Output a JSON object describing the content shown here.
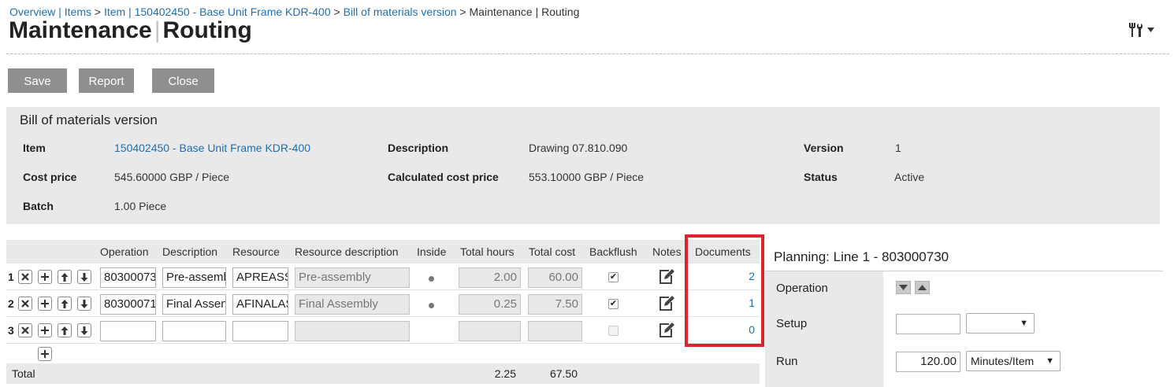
{
  "breadcrumb": {
    "links": [
      "Overview | Items",
      "Item | 150402450 - Base Unit Frame KDR-400",
      "Bill of materials version"
    ],
    "separator": " > ",
    "current": "Maintenance | Routing"
  },
  "title": {
    "part1": "Maintenance",
    "part2": "Routing"
  },
  "toolbar": {
    "save": "Save",
    "report": "Report",
    "close": "Close"
  },
  "bom": {
    "heading": "Bill of materials version",
    "fields": {
      "item_label": "Item",
      "item_value": "150402450 - Base Unit Frame KDR-400",
      "cost_label": "Cost price",
      "cost_value": "545.60000 GBP / Piece",
      "batch_label": "Batch",
      "batch_value": "1.00 Piece",
      "desc_label": "Description",
      "desc_value": "Drawing 07.810.090",
      "calc_label": "Calculated cost price",
      "calc_value": "553.10000 GBP / Piece",
      "version_label": "Version",
      "version_value": "1",
      "status_label": "Status",
      "status_value": "Active"
    }
  },
  "routing": {
    "headers": {
      "operation": "Operation",
      "description": "Description",
      "resource": "Resource",
      "resource_description": "Resource description",
      "inside": "Inside",
      "total_hours": "Total hours",
      "total_cost": "Total cost",
      "backflush": "Backflush",
      "notes": "Notes",
      "documents": "Documents"
    },
    "rows": [
      {
        "num": "1",
        "operation": "80300073",
        "description": "Pre-assemb",
        "resource": "APREASS",
        "resource_description": "Pre-assembly",
        "inside": true,
        "total_hours": "2.00",
        "total_cost": "60.00",
        "backflush": true,
        "documents": "2"
      },
      {
        "num": "2",
        "operation": "80300071",
        "description": "Final Assen",
        "resource": "AFINALAS",
        "resource_description": "Final Assembly",
        "inside": true,
        "total_hours": "0.25",
        "total_cost": "7.50",
        "backflush": true,
        "documents": "1"
      },
      {
        "num": "3",
        "operation": "",
        "description": "",
        "resource": "",
        "resource_description": "",
        "inside": false,
        "total_hours": "",
        "total_cost": "",
        "backflush": false,
        "documents": "0"
      }
    ],
    "total": {
      "label": "Total",
      "hours": "2.25",
      "cost": "67.50"
    }
  },
  "planning": {
    "title": "Planning: Line 1 - 803000730",
    "operation_label": "Operation",
    "setup_label": "Setup",
    "setup_value": "",
    "setup_unit": "",
    "run_label": "Run",
    "run_value": "120.00",
    "run_unit": "Minutes/Item"
  },
  "icons": [
    "delete-icon",
    "add-icon",
    "move-up-icon",
    "move-down-icon",
    "notes-edit-icon",
    "tools-icon",
    "chevron-down-icon",
    "triangle-down-icon",
    "triangle-up-icon"
  ],
  "colors": {
    "link": "#1f6fb2",
    "button": "#8f8f8f",
    "panel": "#e9e9e9",
    "highlight": "#e0222a"
  }
}
